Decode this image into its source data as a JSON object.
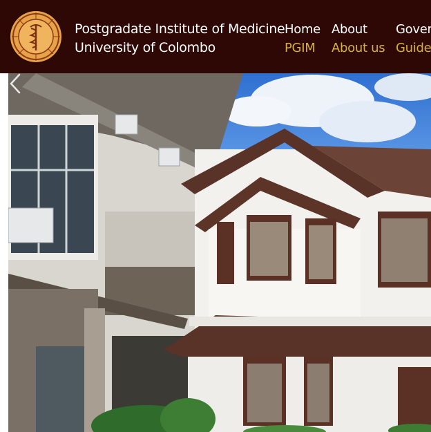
{
  "header": {
    "institute_line1": "Postgradate Institute of Medicine",
    "institute_line2": "University of Colombo",
    "logo_icon": "pgim-emblem-icon"
  },
  "nav": [
    {
      "main": "Home",
      "sub": "PGIM"
    },
    {
      "main": "About",
      "sub": "About us"
    },
    {
      "main": "Gover",
      "sub": "Guide"
    }
  ],
  "hero": {
    "image": "building-photo",
    "prev_icon": "chevron-left-icon"
  },
  "colors": {
    "header_bg": "#2d0805",
    "nav_sub": "#d6b13c",
    "logo_gold": "#e7a24a"
  }
}
